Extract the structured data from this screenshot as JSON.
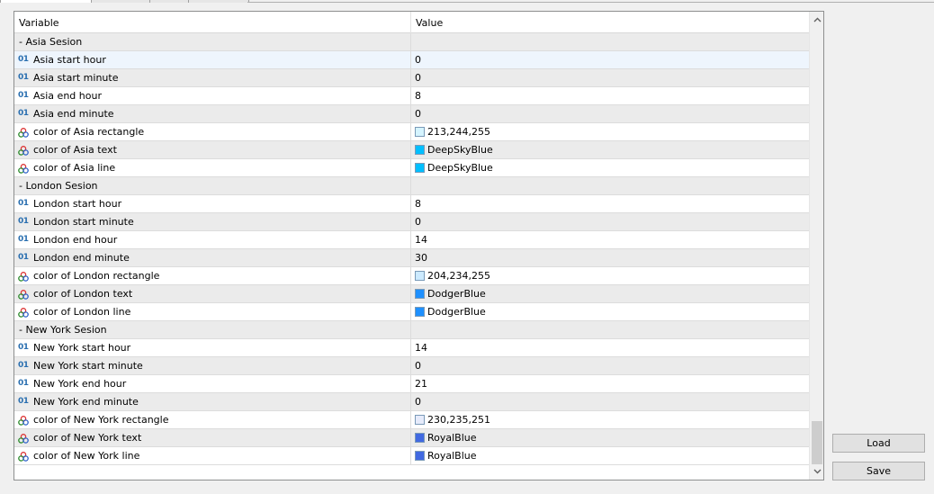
{
  "header": {
    "variable": "Variable",
    "value": "Value"
  },
  "rows": [
    {
      "type": "group",
      "name": "- Asia Sesion"
    },
    {
      "type": "int",
      "name": "Asia start hour",
      "value": "0",
      "selected": true
    },
    {
      "type": "int",
      "name": "Asia start minute",
      "value": "0"
    },
    {
      "type": "int",
      "name": "Asia end hour",
      "value": "8"
    },
    {
      "type": "int",
      "name": "Asia end minute",
      "value": "0"
    },
    {
      "type": "color",
      "name": "color of Asia rectangle",
      "value": "213,244,255",
      "swatch": "#d5f4ff"
    },
    {
      "type": "color",
      "name": "color of Asia text",
      "value": "DeepSkyBlue",
      "swatch": "#00bfff"
    },
    {
      "type": "color",
      "name": "color of Asia line",
      "value": "DeepSkyBlue",
      "swatch": "#00bfff"
    },
    {
      "type": "group",
      "name": "- London Sesion"
    },
    {
      "type": "int",
      "name": "London start hour",
      "value": "8"
    },
    {
      "type": "int",
      "name": "London start minute",
      "value": "0"
    },
    {
      "type": "int",
      "name": "London end hour",
      "value": "14"
    },
    {
      "type": "int",
      "name": "London end minute",
      "value": "30"
    },
    {
      "type": "color",
      "name": "color of London rectangle",
      "value": "204,234,255",
      "swatch": "#cceaff"
    },
    {
      "type": "color",
      "name": "color of London text",
      "value": "DodgerBlue",
      "swatch": "#1e90ff"
    },
    {
      "type": "color",
      "name": "color of London line",
      "value": "DodgerBlue",
      "swatch": "#1e90ff"
    },
    {
      "type": "group",
      "name": "- New York Sesion"
    },
    {
      "type": "int",
      "name": "New York start hour",
      "value": "14"
    },
    {
      "type": "int",
      "name": "New York start minute",
      "value": "0"
    },
    {
      "type": "int",
      "name": "New York end hour",
      "value": "21"
    },
    {
      "type": "int",
      "name": "New York end minute",
      "value": "0"
    },
    {
      "type": "color",
      "name": "color of New York rectangle",
      "value": "230,235,251",
      "swatch": "#e6ebfb"
    },
    {
      "type": "color",
      "name": "color of New York text",
      "value": "RoyalBlue",
      "swatch": "#4169e1"
    },
    {
      "type": "color",
      "name": "color of New York line",
      "value": "RoyalBlue",
      "swatch": "#4169e1"
    }
  ],
  "int_icon_glyph": "01",
  "buttons": {
    "load": "Load",
    "save": "Save"
  }
}
